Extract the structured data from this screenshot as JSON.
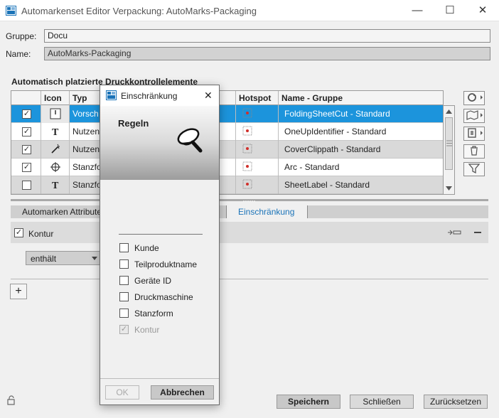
{
  "window": {
    "title": "Automarkenset Editor Verpackung: AutoMarks-Packaging",
    "minimize": "—",
    "maximize": "☐",
    "close": "✕"
  },
  "form": {
    "gruppe_label": "Gruppe:",
    "gruppe_value": "Docu",
    "name_label": "Name:",
    "name_value": "AutoMarks-Packaging"
  },
  "table": {
    "section_title": "Automatisch platzierte Druckkontrollelemente",
    "columns": {
      "icon": "Icon",
      "typ": "Typ",
      "hotspot": "Hotspot",
      "name": "Name - Gruppe"
    },
    "rows": [
      {
        "checked": true,
        "typ": "Vorsch",
        "name": "FoldingSheetCut - Standard",
        "selected": true
      },
      {
        "checked": true,
        "typ": "Nutzen",
        "name": "OneUpIdentifier - Standard",
        "selected": false
      },
      {
        "checked": true,
        "typ": "Nutzen",
        "name": "CoverClippath - Standard",
        "selected": false
      },
      {
        "checked": true,
        "typ": "Stanzfo",
        "name": "Arc - Standard",
        "selected": false
      },
      {
        "checked": false,
        "typ": "Stanzfo",
        "name": "SheetLabel - Standard",
        "selected": false
      }
    ]
  },
  "tabs": {
    "attributes": "Automarken Attribute",
    "restriction": "Einschränkung"
  },
  "kontur": {
    "label": "Kontur",
    "checked": true
  },
  "condition": {
    "selected": "enthält"
  },
  "buttons": {
    "add": "+",
    "save": "Speichern",
    "close": "Schließen",
    "reset": "Zurücksetzen"
  },
  "dialog": {
    "title": "Einschränkung",
    "close": "✕",
    "heading": "Regeln",
    "options": [
      {
        "label": "Kunde",
        "checked": false,
        "disabled": false
      },
      {
        "label": "Teilproduktname",
        "checked": false,
        "disabled": false
      },
      {
        "label": "Geräte ID",
        "checked": false,
        "disabled": false
      },
      {
        "label": "Druckmaschine",
        "checked": false,
        "disabled": false
      },
      {
        "label": "Stanzform",
        "checked": false,
        "disabled": false
      },
      {
        "label": "Kontur",
        "checked": true,
        "disabled": true
      }
    ],
    "ok": "OK",
    "cancel": "Abbrechen"
  },
  "colors": {
    "selection": "#1c94dc",
    "accent_tab": "#1a73b8"
  }
}
